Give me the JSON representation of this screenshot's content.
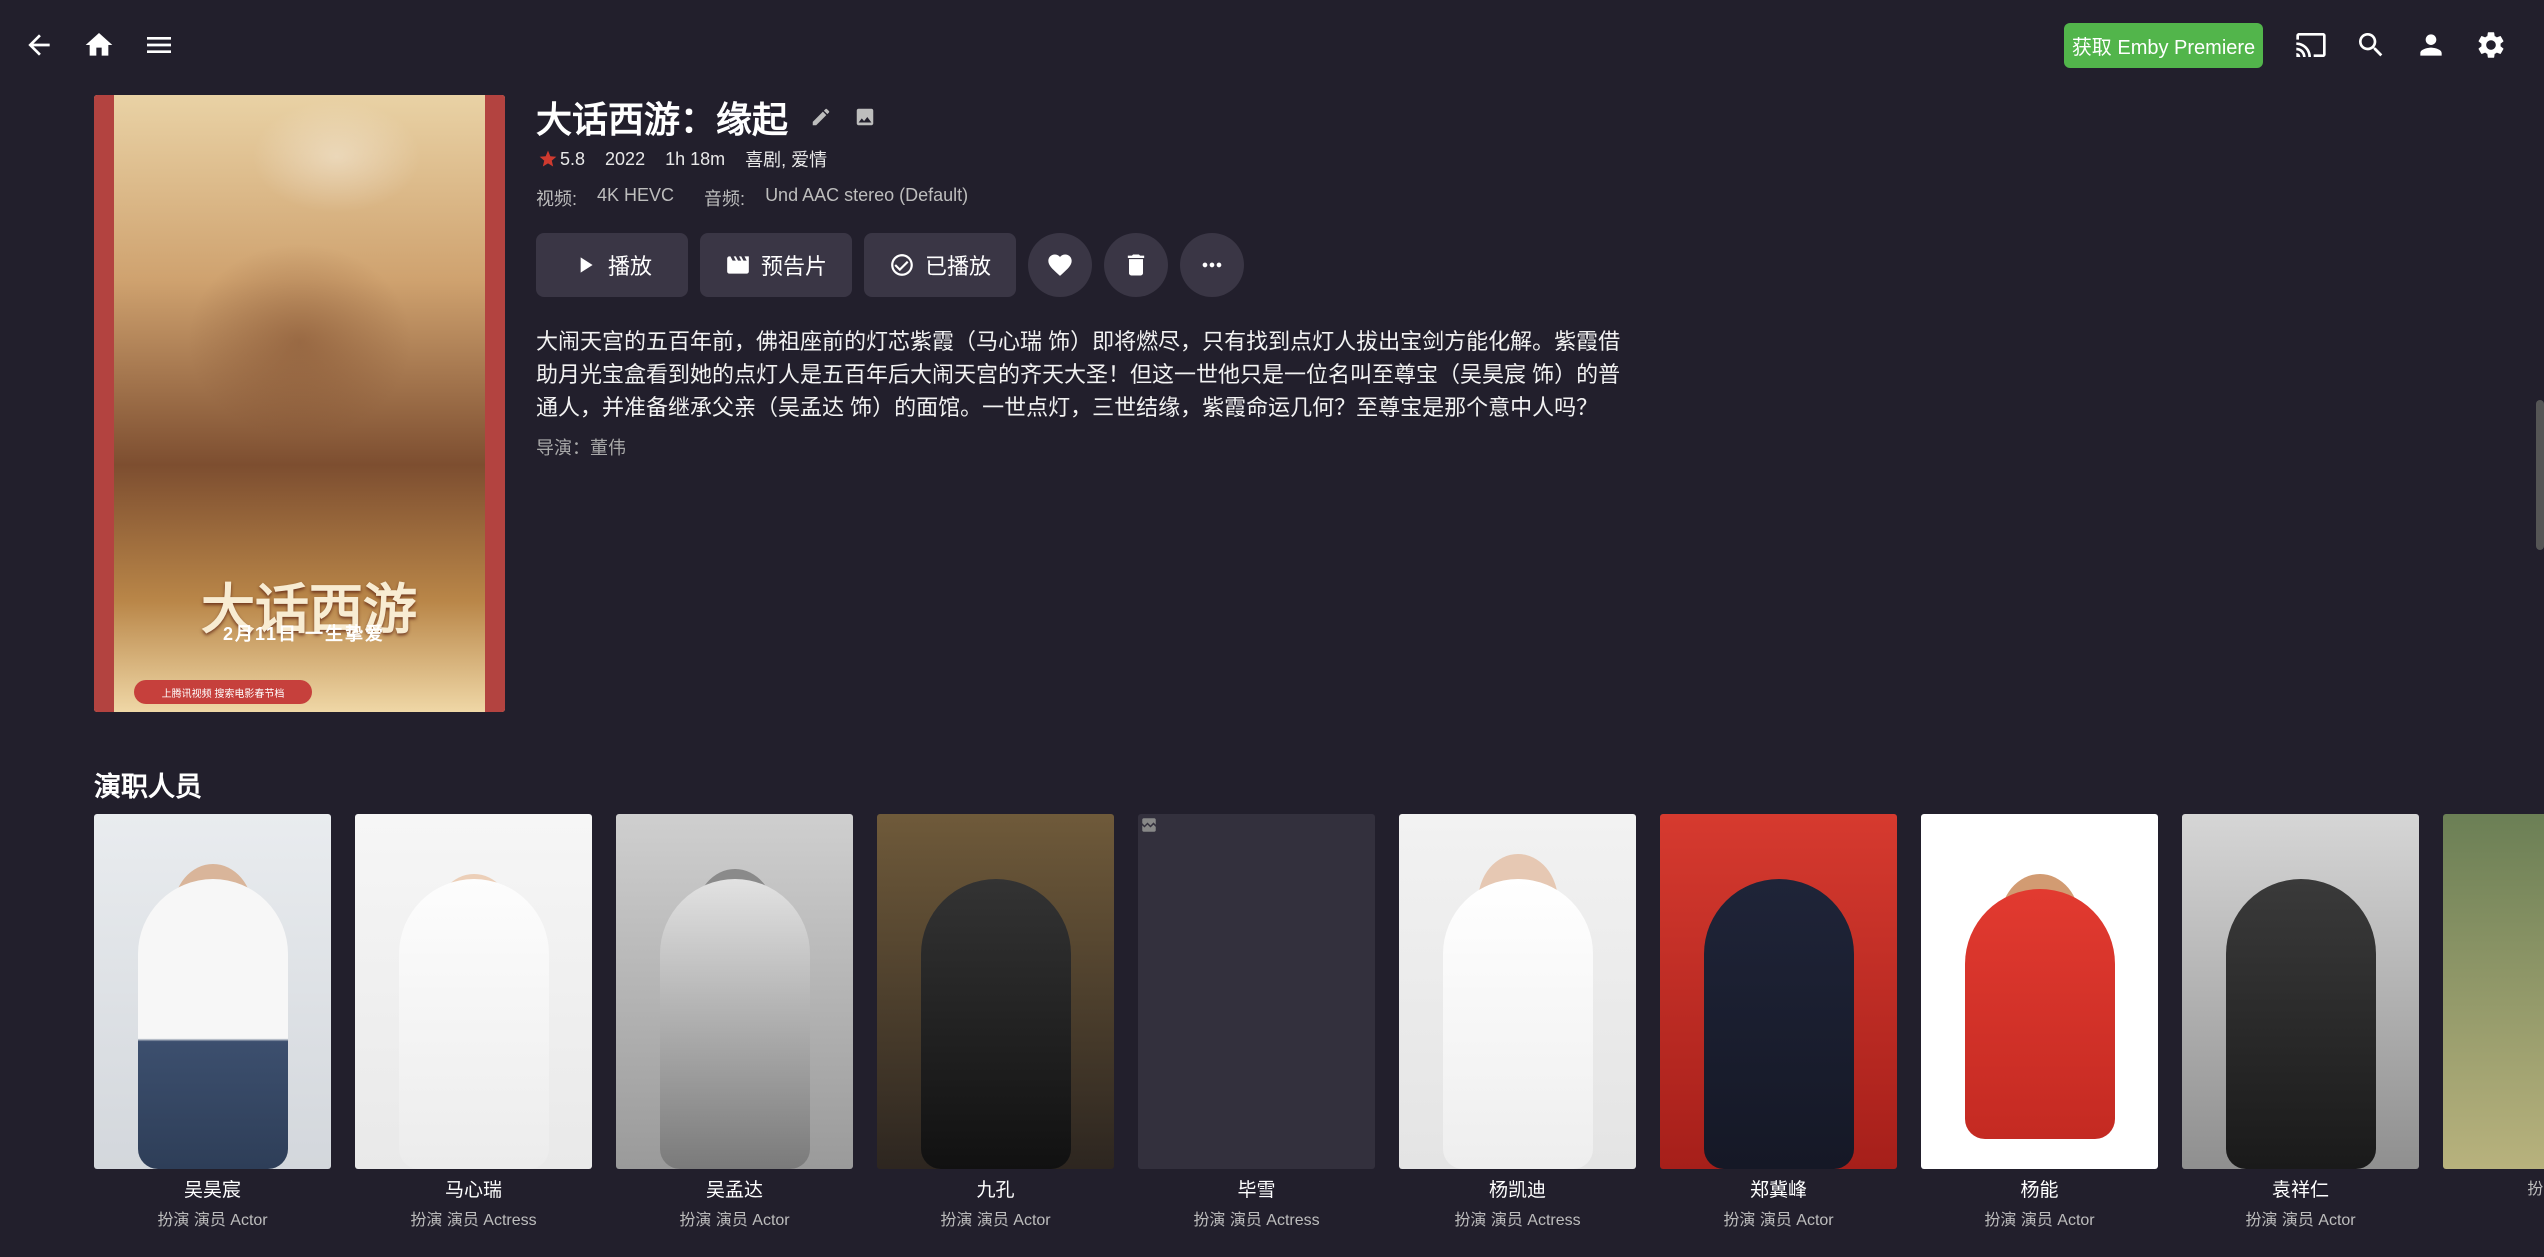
{
  "header": {
    "premiere_label": "获取 Emby Premiere",
    "icons": [
      "back-icon",
      "home-icon",
      "menu-icon",
      "cast-icon",
      "search-icon",
      "user-icon",
      "settings-icon"
    ]
  },
  "item": {
    "title": "大话西游：缘起",
    "rating": "5.8",
    "year": "2022",
    "runtime": "1h 18m",
    "genres": "喜剧, 爱情",
    "video_label": "视频:",
    "video_value": "4K HEVC",
    "audio_label": "音频:",
    "audio_value": "Und AAC stereo (Default)",
    "overview": "大闹天宫的五百年前，佛祖座前的灯芯紫霞（马心瑞 饰）即将燃尽，只有找到点灯人拔出宝剑方能化解。紫霞借助月光宝盒看到她的点灯人是五百年后大闹天宫的齐天大圣！但这一世他只是一位名叫至尊宝（吴昊宸 饰）的普通人，并准备继承父亲（吴孟达 饰）的面馆。一世点灯，三世结缘，紫霞命运几何？至尊宝是那个意中人吗？",
    "director": "导演：董伟",
    "poster": {
      "title": "大话西游",
      "date": "2月11日  一生挚爱",
      "tag": "上腾讯视频 搜索电影春节档"
    }
  },
  "actions": {
    "play": "播放",
    "trailer": "预告片",
    "played": "已播放"
  },
  "cast": {
    "section_title": "演职人员",
    "people": [
      {
        "name": "吴昊宸",
        "role": "扮演 演员 Actor"
      },
      {
        "name": "马心瑞",
        "role": "扮演 演员 Actress"
      },
      {
        "name": "吴孟达",
        "role": "扮演 演员 Actor"
      },
      {
        "name": "九孔",
        "role": "扮演 演员 Actor"
      },
      {
        "name": "毕雪",
        "role": "扮演 演员 Actress"
      },
      {
        "name": "杨凯迪",
        "role": "扮演 演员 Actress"
      },
      {
        "name": "郑冀峰",
        "role": "扮演 演员 Actor"
      },
      {
        "name": "杨能",
        "role": "扮演 演员 Actor"
      },
      {
        "name": "袁祥仁",
        "role": "扮演 演员 Actor"
      },
      {
        "name": "",
        "role": "扮演 演员"
      }
    ]
  },
  "colors": {
    "background": "#221f2c",
    "button": "#3a3645",
    "premiere": "#52b54b",
    "star": "#cf3a2f"
  }
}
